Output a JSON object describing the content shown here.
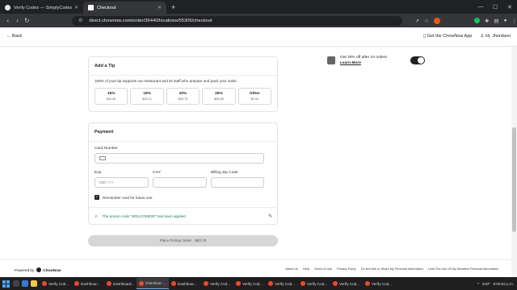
{
  "browser": {
    "tabs": [
      {
        "title": "Verify Codes — SimplyCodes",
        "active": false
      },
      {
        "title": "Checkout",
        "active": true
      }
    ],
    "url": "direct.chownow.com/order/36440/locations/55305/checkout"
  },
  "header": {
    "back_label": "Back",
    "app_label": "Get the ChowNow App",
    "user_label": "Hi, Jhordano"
  },
  "tip": {
    "title": "Add a Tip",
    "subtitle": "100% of your tip supports our restaurant and its staff who prepare and pack your order.",
    "options": [
      {
        "pct": "15%",
        "amt": "$11.59"
      },
      {
        "pct": "18%",
        "amt": "$16.71"
      },
      {
        "pct": "20%",
        "amt": "$20.79"
      },
      {
        "pct": "25%",
        "amt": "$25.98"
      },
      {
        "pct": "Other",
        "amt": "$0.00"
      }
    ]
  },
  "payment": {
    "title": "Payment",
    "card_number_label": "Card Number",
    "exp_label": "Exp",
    "exp_placeholder": "MM / YY",
    "cvv_label": "CVV",
    "zip_label": "Billing Zip Code",
    "remember_label": "Remember card for future use.",
    "promo_text": "The promo code \"WELCOME20\" has been applied"
  },
  "place_order_label": "Place Pickup Order · $83.78",
  "promo_box": {
    "text": "Get 20% off after 10 orders.",
    "link": "Learn More"
  },
  "footer": {
    "powered_by": "Powered by",
    "brand": "ChowNow",
    "links": [
      "About Us",
      "Help",
      "Terms of Use",
      "Privacy Policy",
      "Do Not Sell or Share My Personal Information",
      "Limit The Use Of My Sensitive Personal Information"
    ]
  },
  "taskbar": {
    "items": [
      "Verify Cod...",
      "Dashboar...",
      "Dashboard...",
      "Checkout -...",
      "Dashboar...",
      "Verify Cod...",
      "Verify Cod...",
      "Verify Cod...",
      "Verify Cod...",
      "Verify Cod...",
      "Verify Cod..."
    ],
    "lang": "ESP",
    "time": "8:09:52 p.m."
  }
}
